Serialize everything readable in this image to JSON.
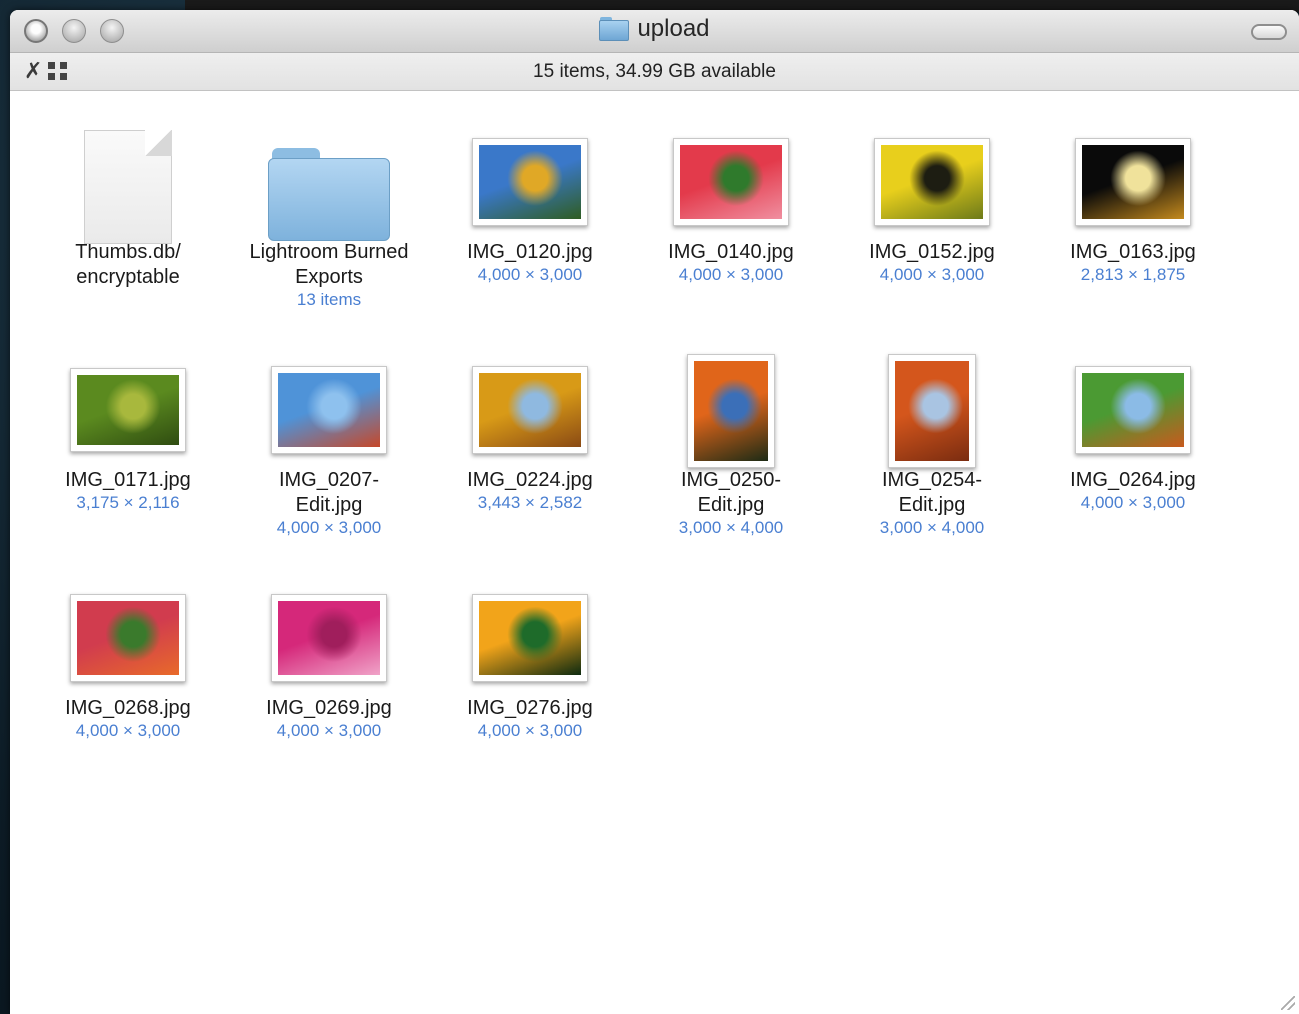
{
  "window": {
    "title": "upload",
    "status": "15 items, 34.99 GB available"
  },
  "items": [
    {
      "name": "Thumbs.db/ encryptable",
      "meta": "",
      "kind": "document-icon"
    },
    {
      "name": "Lightroom Burned Exports",
      "meta": "13 items",
      "kind": "folder-icon"
    },
    {
      "name": "IMG_0120.jpg",
      "meta": "4,000 × 3,000",
      "kind": "image",
      "colors": [
        "#3a78c9",
        "#e0a826",
        "#2f5d22"
      ]
    },
    {
      "name": "IMG_0140.jpg",
      "meta": "4,000 × 3,000",
      "kind": "image",
      "colors": [
        "#e33a4b",
        "#2f7a2c",
        "#f08fa0"
      ]
    },
    {
      "name": "IMG_0152.jpg",
      "meta": "4,000 × 3,000",
      "kind": "image",
      "colors": [
        "#e8cf1c",
        "#1d1d12",
        "#6d7a19"
      ]
    },
    {
      "name": "IMG_0163.jpg",
      "meta": "2,813 × 1,875",
      "kind": "image",
      "colors": [
        "#0a0a0a",
        "#f0e29b",
        "#c48a1d"
      ]
    },
    {
      "name": "IMG_0171.jpg",
      "meta": "3,175 × 2,116",
      "kind": "image",
      "colors": [
        "#5b8a1f",
        "#a8b83d",
        "#2f4c11"
      ]
    },
    {
      "name": "IMG_0207-Edit.jpg",
      "meta": "4,000 × 3,000",
      "kind": "image",
      "colors": [
        "#4f93d8",
        "#8ec1ee",
        "#c6482a"
      ]
    },
    {
      "name": "IMG_0224.jpg",
      "meta": "3,443 × 2,582",
      "kind": "image",
      "colors": [
        "#d89a17",
        "#8fb9e0",
        "#8a4a14"
      ]
    },
    {
      "name": "IMG_0250-Edit.jpg",
      "meta": "3,000 × 4,000",
      "kind": "image",
      "colors": [
        "#e0651a",
        "#3b6fb8",
        "#1d2b15"
      ]
    },
    {
      "name": "IMG_0254-Edit.jpg",
      "meta": "3,000 × 4,000",
      "kind": "image",
      "colors": [
        "#d4561c",
        "#a9c4e2",
        "#7a2c10"
      ]
    },
    {
      "name": "IMG_0264.jpg",
      "meta": "4,000 × 3,000",
      "kind": "image",
      "colors": [
        "#4b9a33",
        "#8bbbe6",
        "#c85a1d"
      ]
    },
    {
      "name": "IMG_0268.jpg",
      "meta": "4,000 × 3,000",
      "kind": "image",
      "colors": [
        "#d13c4e",
        "#3a7a2c",
        "#e86a2a"
      ]
    },
    {
      "name": "IMG_0269.jpg",
      "meta": "4,000 × 3,000",
      "kind": "image",
      "colors": [
        "#d5287a",
        "#a01e5c",
        "#f0a3c8"
      ]
    },
    {
      "name": "IMG_0276.jpg",
      "meta": "4,000 × 3,000",
      "kind": "image",
      "colors": [
        "#f2a41a",
        "#1e6b2a",
        "#0d2a10"
      ]
    }
  ]
}
